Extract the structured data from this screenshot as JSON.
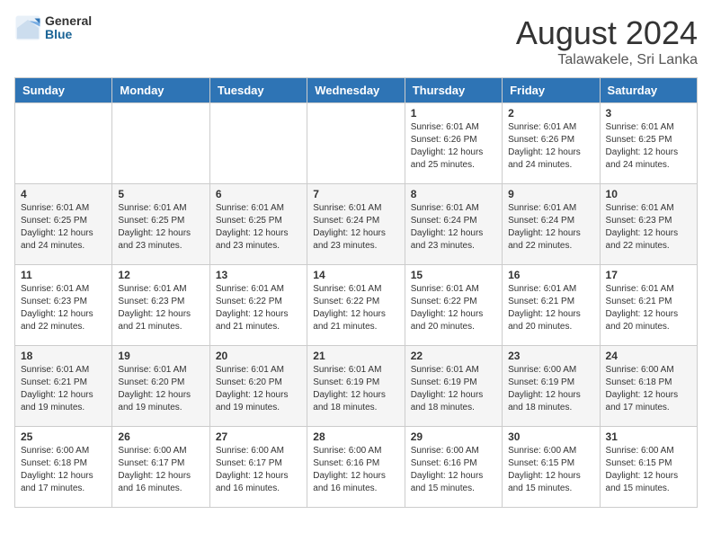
{
  "header": {
    "logo_general": "General",
    "logo_blue": "Blue",
    "month_title": "August 2024",
    "location": "Talawakele, Sri Lanka"
  },
  "days_of_week": [
    "Sunday",
    "Monday",
    "Tuesday",
    "Wednesday",
    "Thursday",
    "Friday",
    "Saturday"
  ],
  "weeks": [
    [
      {
        "day": "",
        "info": ""
      },
      {
        "day": "",
        "info": ""
      },
      {
        "day": "",
        "info": ""
      },
      {
        "day": "",
        "info": ""
      },
      {
        "day": "1",
        "info": "Sunrise: 6:01 AM\nSunset: 6:26 PM\nDaylight: 12 hours\nand 25 minutes."
      },
      {
        "day": "2",
        "info": "Sunrise: 6:01 AM\nSunset: 6:26 PM\nDaylight: 12 hours\nand 24 minutes."
      },
      {
        "day": "3",
        "info": "Sunrise: 6:01 AM\nSunset: 6:25 PM\nDaylight: 12 hours\nand 24 minutes."
      }
    ],
    [
      {
        "day": "4",
        "info": "Sunrise: 6:01 AM\nSunset: 6:25 PM\nDaylight: 12 hours\nand 24 minutes."
      },
      {
        "day": "5",
        "info": "Sunrise: 6:01 AM\nSunset: 6:25 PM\nDaylight: 12 hours\nand 23 minutes."
      },
      {
        "day": "6",
        "info": "Sunrise: 6:01 AM\nSunset: 6:25 PM\nDaylight: 12 hours\nand 23 minutes."
      },
      {
        "day": "7",
        "info": "Sunrise: 6:01 AM\nSunset: 6:24 PM\nDaylight: 12 hours\nand 23 minutes."
      },
      {
        "day": "8",
        "info": "Sunrise: 6:01 AM\nSunset: 6:24 PM\nDaylight: 12 hours\nand 23 minutes."
      },
      {
        "day": "9",
        "info": "Sunrise: 6:01 AM\nSunset: 6:24 PM\nDaylight: 12 hours\nand 22 minutes."
      },
      {
        "day": "10",
        "info": "Sunrise: 6:01 AM\nSunset: 6:23 PM\nDaylight: 12 hours\nand 22 minutes."
      }
    ],
    [
      {
        "day": "11",
        "info": "Sunrise: 6:01 AM\nSunset: 6:23 PM\nDaylight: 12 hours\nand 22 minutes."
      },
      {
        "day": "12",
        "info": "Sunrise: 6:01 AM\nSunset: 6:23 PM\nDaylight: 12 hours\nand 21 minutes."
      },
      {
        "day": "13",
        "info": "Sunrise: 6:01 AM\nSunset: 6:22 PM\nDaylight: 12 hours\nand 21 minutes."
      },
      {
        "day": "14",
        "info": "Sunrise: 6:01 AM\nSunset: 6:22 PM\nDaylight: 12 hours\nand 21 minutes."
      },
      {
        "day": "15",
        "info": "Sunrise: 6:01 AM\nSunset: 6:22 PM\nDaylight: 12 hours\nand 20 minutes."
      },
      {
        "day": "16",
        "info": "Sunrise: 6:01 AM\nSunset: 6:21 PM\nDaylight: 12 hours\nand 20 minutes."
      },
      {
        "day": "17",
        "info": "Sunrise: 6:01 AM\nSunset: 6:21 PM\nDaylight: 12 hours\nand 20 minutes."
      }
    ],
    [
      {
        "day": "18",
        "info": "Sunrise: 6:01 AM\nSunset: 6:21 PM\nDaylight: 12 hours\nand 19 minutes."
      },
      {
        "day": "19",
        "info": "Sunrise: 6:01 AM\nSunset: 6:20 PM\nDaylight: 12 hours\nand 19 minutes."
      },
      {
        "day": "20",
        "info": "Sunrise: 6:01 AM\nSunset: 6:20 PM\nDaylight: 12 hours\nand 19 minutes."
      },
      {
        "day": "21",
        "info": "Sunrise: 6:01 AM\nSunset: 6:19 PM\nDaylight: 12 hours\nand 18 minutes."
      },
      {
        "day": "22",
        "info": "Sunrise: 6:01 AM\nSunset: 6:19 PM\nDaylight: 12 hours\nand 18 minutes."
      },
      {
        "day": "23",
        "info": "Sunrise: 6:00 AM\nSunset: 6:19 PM\nDaylight: 12 hours\nand 18 minutes."
      },
      {
        "day": "24",
        "info": "Sunrise: 6:00 AM\nSunset: 6:18 PM\nDaylight: 12 hours\nand 17 minutes."
      }
    ],
    [
      {
        "day": "25",
        "info": "Sunrise: 6:00 AM\nSunset: 6:18 PM\nDaylight: 12 hours\nand 17 minutes."
      },
      {
        "day": "26",
        "info": "Sunrise: 6:00 AM\nSunset: 6:17 PM\nDaylight: 12 hours\nand 16 minutes."
      },
      {
        "day": "27",
        "info": "Sunrise: 6:00 AM\nSunset: 6:17 PM\nDaylight: 12 hours\nand 16 minutes."
      },
      {
        "day": "28",
        "info": "Sunrise: 6:00 AM\nSunset: 6:16 PM\nDaylight: 12 hours\nand 16 minutes."
      },
      {
        "day": "29",
        "info": "Sunrise: 6:00 AM\nSunset: 6:16 PM\nDaylight: 12 hours\nand 15 minutes."
      },
      {
        "day": "30",
        "info": "Sunrise: 6:00 AM\nSunset: 6:15 PM\nDaylight: 12 hours\nand 15 minutes."
      },
      {
        "day": "31",
        "info": "Sunrise: 6:00 AM\nSunset: 6:15 PM\nDaylight: 12 hours\nand 15 minutes."
      }
    ]
  ]
}
